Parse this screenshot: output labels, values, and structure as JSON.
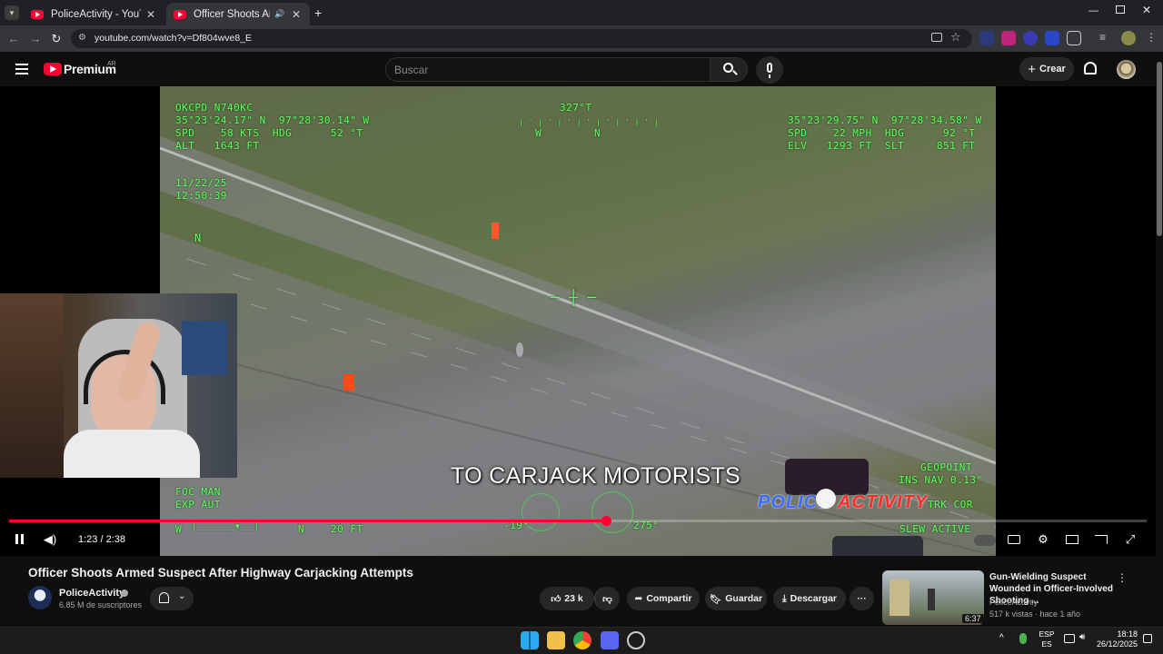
{
  "browser": {
    "tabs": [
      {
        "label": "PoliceActivity - YouTube",
        "active": false
      },
      {
        "label": "Officer Shoots Armed Susp",
        "active": true
      }
    ],
    "url": "youtube.com/watch?v=Df804wve8_E"
  },
  "youtube": {
    "logo_text": "Premium",
    "region_badge": "AR",
    "search_placeholder": "Buscar",
    "create_label": "Crear"
  },
  "video": {
    "hud": {
      "callsign": "OKCPD N740KC",
      "own_position": "35°23'24.17\" N  97°28'30.14\" W",
      "own_speed": "SPD    58 KTS  HDG      52 °T",
      "own_alt": "ALT   1643 FT",
      "heading": "327°T",
      "compass_w": "W",
      "compass_n": "N",
      "target_position": "35°23'29.75\" N  97°28'34.58\" W",
      "target_speed": "SPD    22 MPH  HDG      92 °T",
      "target_elev": "ELV   1293 FT  SLT     851 FT",
      "date": "11/22/25",
      "time": "12:50:39",
      "north_marker": "N",
      "foc_mode": "FOC MAN",
      "exp_mode": "EXP AUT",
      "bottom_w": "W",
      "bottom_n": "N",
      "altitude_scale": "20 FT",
      "angle_left": "-19°",
      "angle_right": "275°",
      "geopoint": "GEOPOINT",
      "ins_nav": "INS NAV 0.13°",
      "trk": "TRK COR",
      "slew": "SLEW ACTIVE"
    },
    "caption": "TO CARJACK MOTORISTS",
    "watermark_left": "POLICE",
    "watermark_right": "ACTIVITY",
    "current_time": "1:23",
    "duration": "2:38",
    "progress": 0.525,
    "time_display": "1:23 / 2:38"
  },
  "info": {
    "title": "Officer Shoots Armed Suspect After Highway Carjacking Attempts",
    "channel_name": "PoliceActivity",
    "subscribers": "6.85 M de suscriptores",
    "likes": "23 k",
    "share_label": "Compartir",
    "save_label": "Guardar",
    "download_label": "Descargar"
  },
  "recommendation": {
    "title": "Gun-Wielding Suspect Wounded in Officer-Involved Shooting ...",
    "channel": "PoliceActivity",
    "meta": "517 k vistas · hace 1 año",
    "duration": "6:37"
  },
  "taskbar": {
    "lang_top": "ESP",
    "lang_bottom": "ES",
    "time": "18:18",
    "date": "26/12/2025"
  },
  "colors": {
    "accent": "#ff0033",
    "hud_green": "#5dff5d",
    "background": "#0f0f0f"
  }
}
